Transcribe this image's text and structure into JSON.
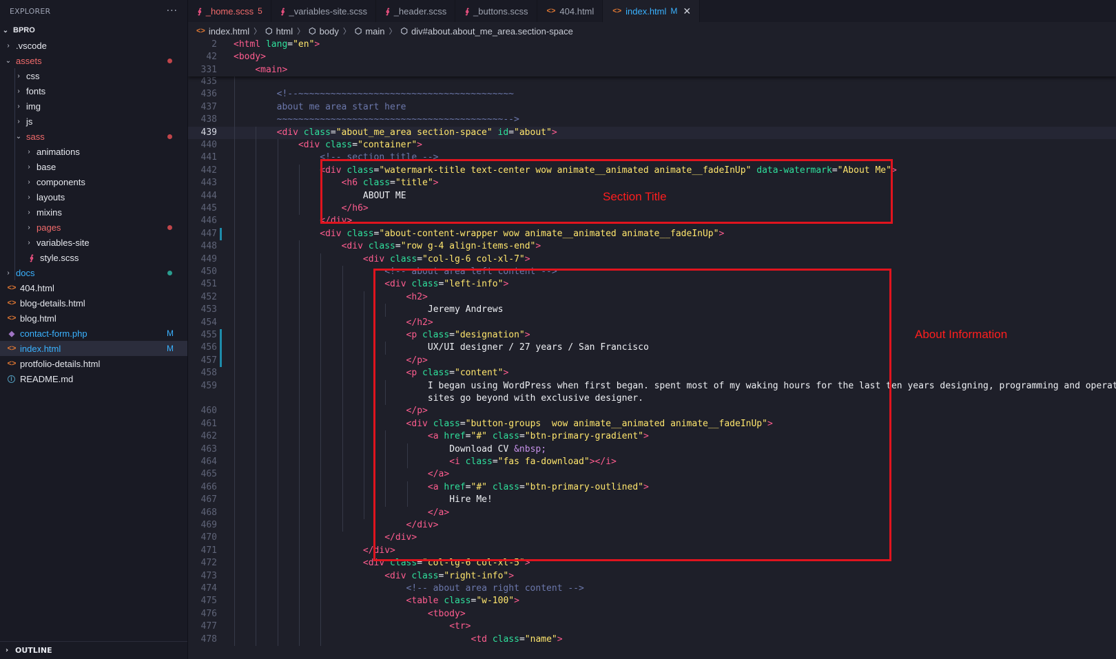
{
  "sidebar": {
    "title": "EXPLORER",
    "more_glyph": "···",
    "root": "BPRO",
    "items": [
      {
        "label": ".vscode",
        "kind": "folder",
        "open": false,
        "level": 1
      },
      {
        "label": "assets",
        "kind": "folder",
        "open": true,
        "level": 1,
        "color": "#f26b6b",
        "dot": "#c0454a"
      },
      {
        "label": "css",
        "kind": "folder",
        "open": false,
        "level": 2
      },
      {
        "label": "fonts",
        "kind": "folder",
        "open": false,
        "level": 2
      },
      {
        "label": "img",
        "kind": "folder",
        "open": false,
        "level": 2
      },
      {
        "label": "js",
        "kind": "folder",
        "open": false,
        "level": 2
      },
      {
        "label": "sass",
        "kind": "folder",
        "open": true,
        "level": 2,
        "color": "#f26b6b",
        "dot": "#c0454a"
      },
      {
        "label": "animations",
        "kind": "folder",
        "open": false,
        "level": 3
      },
      {
        "label": "base",
        "kind": "folder",
        "open": false,
        "level": 3
      },
      {
        "label": "components",
        "kind": "folder",
        "open": false,
        "level": 3
      },
      {
        "label": "layouts",
        "kind": "folder",
        "open": false,
        "level": 3
      },
      {
        "label": "mixins",
        "kind": "folder",
        "open": false,
        "level": 3
      },
      {
        "label": "pages",
        "kind": "folder",
        "open": false,
        "level": 3,
        "color": "#f26b6b",
        "dot": "#c0454a"
      },
      {
        "label": "variables-site",
        "kind": "folder",
        "open": false,
        "level": 3
      },
      {
        "label": "style.scss",
        "kind": "scss",
        "level": 3
      },
      {
        "label": "docs",
        "kind": "folder",
        "open": false,
        "level": 1,
        "color": "#3ab2ff",
        "dot": "#2a9d8f"
      },
      {
        "label": "404.html",
        "kind": "html",
        "level": 1
      },
      {
        "label": "blog-details.html",
        "kind": "html",
        "level": 1
      },
      {
        "label": "blog.html",
        "kind": "html",
        "level": 1
      },
      {
        "label": "contact-form.php",
        "kind": "php",
        "level": 1,
        "color": "#3ab2ff",
        "badge": "M"
      },
      {
        "label": "index.html",
        "kind": "html",
        "level": 1,
        "color": "#3ab2ff",
        "badge": "M",
        "selected": true
      },
      {
        "label": "protfolio-details.html",
        "kind": "html",
        "level": 1
      },
      {
        "label": "README.md",
        "kind": "info",
        "level": 1
      }
    ],
    "outline_label": "OUTLINE"
  },
  "tabs": [
    {
      "label": "_home.scss",
      "kind": "scss",
      "badge": "5",
      "color": "#f26b6b",
      "badge_color": "#f26b6b"
    },
    {
      "label": "_variables-site.scss",
      "kind": "scss"
    },
    {
      "label": "_header.scss",
      "kind": "scss"
    },
    {
      "label": "_buttons.scss",
      "kind": "scss"
    },
    {
      "label": "404.html",
      "kind": "html"
    },
    {
      "label": "index.html",
      "kind": "html",
      "badge": "M",
      "active": true,
      "close": "✕"
    }
  ],
  "breadcrumb": [
    {
      "label": "index.html",
      "icon": "html"
    },
    {
      "label": "html",
      "icon": "cube"
    },
    {
      "label": "body",
      "icon": "cube"
    },
    {
      "label": "main",
      "icon": "cube"
    },
    {
      "label": "div#about.about_me_area.section-space",
      "icon": "cube"
    }
  ],
  "sticky_lines": [
    {
      "n": "2",
      "indent": 0,
      "tokens": [
        [
          "tg",
          "<html "
        ],
        [
          "at",
          "lang"
        ],
        [
          "tx",
          "="
        ],
        [
          "st",
          "\"en\""
        ],
        [
          "tg",
          ">"
        ]
      ]
    },
    {
      "n": "42",
      "indent": 0,
      "tokens": [
        [
          "tg",
          "<body>"
        ]
      ]
    },
    {
      "n": "331",
      "indent": 1,
      "tokens": [
        [
          "tg",
          "<main>"
        ]
      ]
    }
  ],
  "code_lines": [
    {
      "n": "435",
      "indent": 0,
      "tokens": []
    },
    {
      "n": "436",
      "indent": 2,
      "tokens": [
        [
          "cm",
          "<!--~~~~~~~~~~~~~~~~~~~~~~~~~~~~~~~~~~~~~~~~"
        ]
      ]
    },
    {
      "n": "437",
      "indent": 2,
      "tokens": [
        [
          "cm",
          "about me area start here"
        ]
      ]
    },
    {
      "n": "438",
      "indent": 2,
      "tokens": [
        [
          "cm",
          "~~~~~~~~~~~~~~~~~~~~~~~~~~~~~~~~~~~~~~~~~~-->"
        ]
      ]
    },
    {
      "n": "439",
      "indent": 2,
      "current": true,
      "tokens": [
        [
          "tg",
          "<div "
        ],
        [
          "at",
          "class"
        ],
        [
          "tx",
          "="
        ],
        [
          "st",
          "\"about_me_area section-space\""
        ],
        [
          "tx",
          " "
        ],
        [
          "at",
          "id"
        ],
        [
          "tx",
          "="
        ],
        [
          "st",
          "\"about\""
        ],
        [
          "tg",
          ">"
        ]
      ]
    },
    {
      "n": "440",
      "indent": 3,
      "tokens": [
        [
          "tg",
          "<div "
        ],
        [
          "at",
          "class"
        ],
        [
          "tx",
          "="
        ],
        [
          "st",
          "\"container\""
        ],
        [
          "tg",
          ">"
        ]
      ]
    },
    {
      "n": "441",
      "indent": 4,
      "tokens": [
        [
          "cm",
          "<!-- section title -->"
        ]
      ]
    },
    {
      "n": "442",
      "indent": 4,
      "tokens": [
        [
          "tg",
          "<div "
        ],
        [
          "at",
          "class"
        ],
        [
          "tx",
          "="
        ],
        [
          "st",
          "\"watermark-title text-center wow animate__animated animate__fadeInUp\""
        ],
        [
          "tx",
          " "
        ],
        [
          "at",
          "data-watermark"
        ],
        [
          "tx",
          "="
        ],
        [
          "st",
          "\"About Me\""
        ],
        [
          "tg",
          ">"
        ]
      ]
    },
    {
      "n": "443",
      "indent": 5,
      "tokens": [
        [
          "tg",
          "<h6 "
        ],
        [
          "at",
          "class"
        ],
        [
          "tx",
          "="
        ],
        [
          "st",
          "\"title\""
        ],
        [
          "tg",
          ">"
        ]
      ]
    },
    {
      "n": "444",
      "indent": 6,
      "tokens": [
        [
          "tx",
          "ABOUT ME"
        ]
      ]
    },
    {
      "n": "445",
      "indent": 5,
      "tokens": [
        [
          "tg",
          "</h6>"
        ]
      ]
    },
    {
      "n": "446",
      "indent": 4,
      "tokens": [
        [
          "tg",
          "</div>"
        ]
      ]
    },
    {
      "n": "447",
      "indent": 4,
      "tokens": [
        [
          "tg",
          "<div "
        ],
        [
          "at",
          "class"
        ],
        [
          "tx",
          "="
        ],
        [
          "st",
          "\"about-content-wrapper wow animate__animated animate__fadeInUp\""
        ],
        [
          "tg",
          ">"
        ]
      ]
    },
    {
      "n": "448",
      "indent": 5,
      "tokens": [
        [
          "tg",
          "<div "
        ],
        [
          "at",
          "class"
        ],
        [
          "tx",
          "="
        ],
        [
          "st",
          "\"row g-4 align-items-end\""
        ],
        [
          "tg",
          ">"
        ]
      ]
    },
    {
      "n": "449",
      "indent": 6,
      "tokens": [
        [
          "tg",
          "<div "
        ],
        [
          "at",
          "class"
        ],
        [
          "tx",
          "="
        ],
        [
          "st",
          "\"col-lg-6 col-xl-7\""
        ],
        [
          "tg",
          ">"
        ]
      ]
    },
    {
      "n": "450",
      "indent": 7,
      "tokens": [
        [
          "cm",
          "<!-- about area left content -->"
        ]
      ]
    },
    {
      "n": "451",
      "indent": 7,
      "tokens": [
        [
          "tg",
          "<div "
        ],
        [
          "at",
          "class"
        ],
        [
          "tx",
          "="
        ],
        [
          "st",
          "\"left-info\""
        ],
        [
          "tg",
          ">"
        ]
      ]
    },
    {
      "n": "452",
      "indent": 8,
      "tokens": [
        [
          "tg",
          "<h2>"
        ]
      ]
    },
    {
      "n": "453",
      "indent": 9,
      "tokens": [
        [
          "tx",
          "Jeremy Andrews"
        ]
      ]
    },
    {
      "n": "454",
      "indent": 8,
      "tokens": [
        [
          "tg",
          "</h2>"
        ]
      ]
    },
    {
      "n": "455",
      "indent": 8,
      "tokens": [
        [
          "tg",
          "<p "
        ],
        [
          "at",
          "class"
        ],
        [
          "tx",
          "="
        ],
        [
          "st",
          "\"designation\""
        ],
        [
          "tg",
          ">"
        ]
      ]
    },
    {
      "n": "456",
      "indent": 9,
      "tokens": [
        [
          "tx",
          "UX/UI designer / 27 years / San Francisco"
        ]
      ]
    },
    {
      "n": "457",
      "indent": 8,
      "tokens": [
        [
          "tg",
          "</p>"
        ]
      ]
    },
    {
      "n": "458",
      "indent": 8,
      "tokens": [
        [
          "tg",
          "<p "
        ],
        [
          "at",
          "class"
        ],
        [
          "tx",
          "="
        ],
        [
          "st",
          "\"content\""
        ],
        [
          "tg",
          ">"
        ]
      ]
    },
    {
      "n": "459",
      "indent": 9,
      "tokens": [
        [
          "tx",
          "I began using WordPress when first began. spent most of my waking hours for the last ten years designing, programming and operating WordPress"
        ]
      ]
    },
    {
      "n": "",
      "indent": 9,
      "tokens": [
        [
          "tx",
          "sites go beyond with exclusive designer."
        ]
      ]
    },
    {
      "n": "460",
      "indent": 8,
      "tokens": [
        [
          "tg",
          "</p>"
        ]
      ]
    },
    {
      "n": "461",
      "indent": 8,
      "tokens": [
        [
          "tg",
          "<div "
        ],
        [
          "at",
          "class"
        ],
        [
          "tx",
          "="
        ],
        [
          "st",
          "\"button-groups  wow animate__animated animate__fadeInUp\""
        ],
        [
          "tg",
          ">"
        ]
      ]
    },
    {
      "n": "462",
      "indent": 9,
      "tokens": [
        [
          "tg",
          "<a "
        ],
        [
          "at",
          "href"
        ],
        [
          "tx",
          "="
        ],
        [
          "st",
          "\"#\""
        ],
        [
          "tx",
          " "
        ],
        [
          "at",
          "class"
        ],
        [
          "tx",
          "="
        ],
        [
          "st",
          "\"btn-primary-gradient\""
        ],
        [
          "tg",
          ">"
        ]
      ]
    },
    {
      "n": "463",
      "indent": 10,
      "tokens": [
        [
          "tx",
          "Download CV "
        ],
        [
          "ent",
          "&nbsp;"
        ]
      ]
    },
    {
      "n": "464",
      "indent": 10,
      "tokens": [
        [
          "tg",
          "<i "
        ],
        [
          "at",
          "class"
        ],
        [
          "tx",
          "="
        ],
        [
          "st",
          "\"fas fa-download\""
        ],
        [
          "tg",
          "></i>"
        ]
      ]
    },
    {
      "n": "465",
      "indent": 9,
      "tokens": [
        [
          "tg",
          "</a>"
        ]
      ]
    },
    {
      "n": "466",
      "indent": 9,
      "tokens": [
        [
          "tg",
          "<a "
        ],
        [
          "at",
          "href"
        ],
        [
          "tx",
          "="
        ],
        [
          "st",
          "\"#\""
        ],
        [
          "tx",
          " "
        ],
        [
          "at",
          "class"
        ],
        [
          "tx",
          "="
        ],
        [
          "st",
          "\"btn-primary-outlined\""
        ],
        [
          "tg",
          ">"
        ]
      ]
    },
    {
      "n": "467",
      "indent": 10,
      "tokens": [
        [
          "tx",
          "Hire Me!"
        ]
      ]
    },
    {
      "n": "468",
      "indent": 9,
      "tokens": [
        [
          "tg",
          "</a>"
        ]
      ]
    },
    {
      "n": "469",
      "indent": 8,
      "tokens": [
        [
          "tg",
          "</div>"
        ]
      ]
    },
    {
      "n": "470",
      "indent": 7,
      "tokens": [
        [
          "tg",
          "</div>"
        ]
      ]
    },
    {
      "n": "471",
      "indent": 6,
      "tokens": [
        [
          "tg",
          "</div>"
        ]
      ]
    },
    {
      "n": "472",
      "indent": 6,
      "tokens": [
        [
          "tg",
          "<div "
        ],
        [
          "at",
          "class"
        ],
        [
          "tx",
          "="
        ],
        [
          "st",
          "\"col-lg-6 col-xl-5\""
        ],
        [
          "tg",
          ">"
        ]
      ]
    },
    {
      "n": "473",
      "indent": 7,
      "tokens": [
        [
          "tg",
          "<div "
        ],
        [
          "at",
          "class"
        ],
        [
          "tx",
          "="
        ],
        [
          "st",
          "\"right-info\""
        ],
        [
          "tg",
          ">"
        ]
      ]
    },
    {
      "n": "474",
      "indent": 8,
      "tokens": [
        [
          "cm",
          "<!-- about area right content -->"
        ]
      ]
    },
    {
      "n": "475",
      "indent": 8,
      "tokens": [
        [
          "tg",
          "<table "
        ],
        [
          "at",
          "class"
        ],
        [
          "tx",
          "="
        ],
        [
          "st",
          "\"w-100\""
        ],
        [
          "tg",
          ">"
        ]
      ]
    },
    {
      "n": "476",
      "indent": 9,
      "tokens": [
        [
          "tg",
          "<tbody>"
        ]
      ]
    },
    {
      "n": "477",
      "indent": 10,
      "tokens": [
        [
          "tg",
          "<tr>"
        ]
      ]
    },
    {
      "n": "478",
      "indent": 11,
      "tokens": [
        [
          "tg",
          "<td "
        ],
        [
          "at",
          "class"
        ],
        [
          "tx",
          "="
        ],
        [
          "st",
          "\"name\""
        ],
        [
          "tg",
          ">"
        ]
      ]
    }
  ],
  "annotations": [
    {
      "label": "Section Title"
    },
    {
      "label": "About Information"
    }
  ],
  "colors": {
    "tag": "#ff5d8f",
    "attr": "#2fe09c",
    "string": "#ffe66d",
    "comment": "#6c78ac",
    "accent": "#3ab2ff",
    "annotation": "#e0141e"
  }
}
